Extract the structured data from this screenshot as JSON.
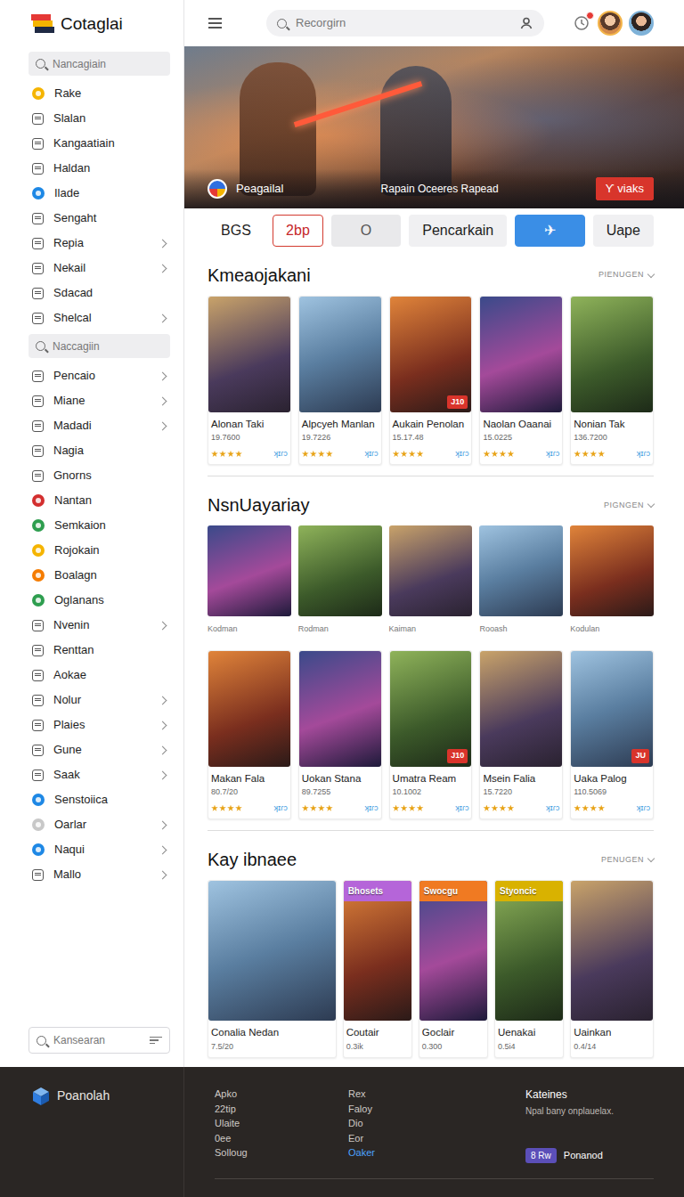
{
  "sidebar": {
    "logo": "Cotaglai",
    "entries": [
      {
        "kind": "search",
        "placeholder": "Nancagiain"
      },
      {
        "kind": "dot",
        "label": "Rake",
        "color": "#f5b400",
        "expandable": false
      },
      {
        "kind": "glyph",
        "label": "Slalan",
        "color": "#555555",
        "expandable": false
      },
      {
        "kind": "glyph",
        "label": "Kangaatiain",
        "color": "#555555",
        "expandable": false
      },
      {
        "kind": "glyph",
        "label": "Haldan",
        "color": "#555555",
        "expandable": false
      },
      {
        "kind": "dot",
        "label": "Ilade",
        "color": "#1e88e5",
        "expandable": false
      },
      {
        "kind": "glyph",
        "label": "Sengaht",
        "color": "#555555",
        "expandable": false
      },
      {
        "kind": "glyph",
        "label": "Repia",
        "color": "#555555",
        "expandable": true
      },
      {
        "kind": "glyph",
        "label": "Nekail",
        "color": "#555555",
        "expandable": true
      },
      {
        "kind": "glyph",
        "label": "Sdacad",
        "color": "#555555",
        "expandable": false
      },
      {
        "kind": "glyph",
        "label": "Shelcal",
        "color": "#555555",
        "expandable": true
      },
      {
        "kind": "search",
        "placeholder": "Naccagiin"
      },
      {
        "kind": "glyph",
        "label": "Pencaio",
        "color": "#555555",
        "expandable": true
      },
      {
        "kind": "glyph",
        "label": "Miane",
        "color": "#555555",
        "expandable": true
      },
      {
        "kind": "glyph",
        "label": "Madadi",
        "color": "#555555",
        "expandable": true
      },
      {
        "kind": "glyph",
        "label": "Nagia",
        "color": "#555555",
        "expandable": false
      },
      {
        "kind": "glyph",
        "label": "Gnorns",
        "color": "#555555",
        "expandable": false
      },
      {
        "kind": "dot",
        "label": "Nantan",
        "color": "#d32f2f",
        "expandable": false
      },
      {
        "kind": "dot",
        "label": "Semkaion",
        "color": "#2e9e4f",
        "expandable": false
      },
      {
        "kind": "dot",
        "label": "Rojokain",
        "color": "#f5b400",
        "expandable": false
      },
      {
        "kind": "dot",
        "label": "Boalagn",
        "color": "#f57c00",
        "expandable": false
      },
      {
        "kind": "dot",
        "label": "Oglanans",
        "color": "#2e9e4f",
        "expandable": false
      },
      {
        "kind": "glyph",
        "label": "Nvenin",
        "color": "#555555",
        "expandable": true
      },
      {
        "kind": "glyph",
        "label": "Renttan",
        "color": "#555555",
        "expandable": false
      },
      {
        "kind": "glyph",
        "label": "Aokae",
        "color": "#555555",
        "expandable": false
      },
      {
        "kind": "glyph",
        "label": "Nolur",
        "color": "#555555",
        "expandable": true
      },
      {
        "kind": "glyph",
        "label": "Plaies",
        "color": "#555555",
        "expandable": true
      },
      {
        "kind": "glyph",
        "label": "Gune",
        "color": "#555555",
        "expandable": true
      },
      {
        "kind": "glyph",
        "label": "Saak",
        "color": "#555555",
        "expandable": true
      },
      {
        "kind": "dot",
        "label": "Senstoiica",
        "color": "#1e88e5",
        "expandable": false
      },
      {
        "kind": "dot",
        "label": "Oarlar",
        "color": "#c8c8c8",
        "expandable": true
      },
      {
        "kind": "dot",
        "label": "Naqui",
        "color": "#1e88e5",
        "expandable": true
      },
      {
        "kind": "glyph",
        "label": "Mallo",
        "color": "#555555",
        "expandable": true
      }
    ],
    "bottom_search": {
      "placeholder": "Kansearan"
    }
  },
  "topbar": {
    "search": {
      "placeholder": "Recorgirn"
    },
    "notification": {
      "unread": true
    }
  },
  "hero": {
    "brand": "Peagailal",
    "caption": "Rapain Oceeres Rapead",
    "button": "Ƴ viaks"
  },
  "chips": [
    {
      "label": "BGS",
      "kind": "plain",
      "selected": false
    },
    {
      "label": "2bp",
      "kind": "outline",
      "selected": false
    },
    {
      "label": "O",
      "kind": "grey",
      "selected": false
    },
    {
      "label": "Pencarkain",
      "kind": "light",
      "selected": false
    },
    {
      "label": "✈",
      "kind": "primary",
      "selected": true
    },
    {
      "label": "Uape",
      "kind": "light",
      "selected": false
    }
  ],
  "sections": [
    {
      "kind": "cards",
      "title": "Kmeaojakani",
      "more": "PIENUGEN",
      "cards": [
        {
          "title": "Alonan Taki",
          "count": "19.7600",
          "stars": 4,
          "tag": "ʞɪɾɔ"
        },
        {
          "title": "Alpcyeh Manlan",
          "count": "19.7226",
          "stars": 4,
          "tag": "ʞɪɾɔ"
        },
        {
          "title": "Aukain Penolan",
          "count": "15.17.48",
          "stars": 4,
          "tag": "ʞɪɾɔ",
          "badge": "J10"
        },
        {
          "title": "Naolan Oaanai",
          "count": "15.0225",
          "stars": 4,
          "tag": "ʞɪɾɔ"
        },
        {
          "title": "Nonian Tak",
          "count": "136.7200",
          "stars": 4,
          "tag": "ʞɪɾɔ"
        }
      ]
    },
    {
      "kind": "tiles",
      "title": "NsnUayariay",
      "more": "PIGNGEN",
      "tiles": [
        {
          "label": "Kodman"
        },
        {
          "label": "Rodman"
        },
        {
          "label": "Kaiman"
        },
        {
          "label": "Rooash"
        },
        {
          "label": "Kodulan"
        }
      ],
      "cards": [
        {
          "title": "Makan Fala",
          "count": "80.7/20",
          "stars": 4,
          "tag": "ʞɪɾɔ"
        },
        {
          "title": "Uokan Stana",
          "count": "89.7255",
          "stars": 4,
          "tag": "ʞɪɾɔ"
        },
        {
          "title": "Umatra Ream",
          "count": "10.1002",
          "stars": 4,
          "tag": "ʞɪɾɔ",
          "badge": "J10"
        },
        {
          "title": "Msein Falia",
          "count": "15.7220",
          "stars": 4,
          "tag": "ʞɪɾɔ"
        },
        {
          "title": "Uaka Palog",
          "count": "110.5069",
          "stars": 4,
          "tag": "ʞɪɾɔ",
          "badge": "JU"
        }
      ]
    },
    {
      "kind": "feature",
      "title": "Kay ibnaee",
      "more": "PENUGEN",
      "cards": [
        {
          "title": "Conalia Nedan",
          "count": "7.5/20"
        },
        {
          "title": "Coutair",
          "count": "0.3ik",
          "ribbon": {
            "label": "Bhosets",
            "color": "#b565d9"
          }
        },
        {
          "title": "Goclair",
          "count": "0.300",
          "ribbon": {
            "label": "Swocgu",
            "color": "#f07a22"
          }
        },
        {
          "title": "Uenakai",
          "count": "0.5i4",
          "ribbon": {
            "label": "Styoncic",
            "color": "#d9b200"
          }
        },
        {
          "title": "Uainkan",
          "count": "0.4/14"
        }
      ]
    }
  ],
  "footer": {
    "logo": "Poanolah",
    "columns": [
      [
        {
          "label": "Apko",
          "active": false
        },
        {
          "label": "22tip",
          "active": false
        },
        {
          "label": "Ulaite",
          "active": false
        },
        {
          "label": "0ee",
          "active": false
        },
        {
          "label": "Solloug",
          "active": false
        }
      ],
      [
        {
          "label": "Rex",
          "active": false
        },
        {
          "label": "Faloy",
          "active": false
        },
        {
          "label": "Dio",
          "active": false
        },
        {
          "label": "Eor",
          "active": false
        },
        {
          "label": "Oaker",
          "active": true
        }
      ]
    ],
    "about": {
      "title": "Kateines",
      "text": "Npal bany onplauelax.",
      "button_tag": "8 Rw",
      "button": "Ponanod"
    }
  }
}
